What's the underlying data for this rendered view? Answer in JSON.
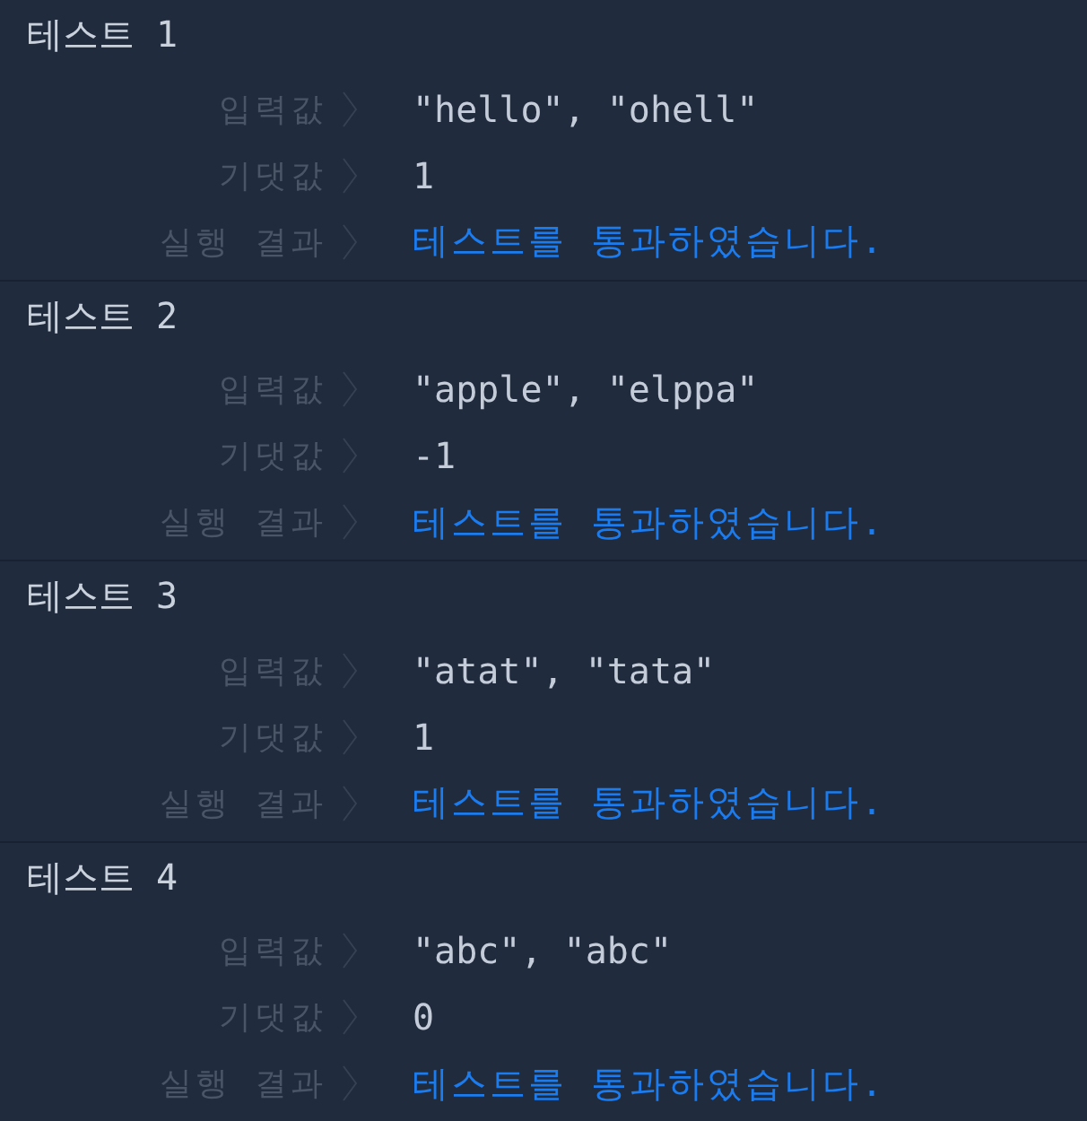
{
  "tests": [
    {
      "title": "테스트 1",
      "rows": [
        {
          "label": "입력값",
          "value": "\"hello\", \"ohell\"",
          "kind": "value"
        },
        {
          "label": "기댓값",
          "value": "1",
          "kind": "value"
        },
        {
          "label": "실행 결과",
          "value": "테스트를 통과하였습니다.",
          "kind": "result"
        }
      ]
    },
    {
      "title": "테스트 2",
      "rows": [
        {
          "label": "입력값",
          "value": "\"apple\", \"elppa\"",
          "kind": "value"
        },
        {
          "label": "기댓값",
          "value": "-1",
          "kind": "value"
        },
        {
          "label": "실행 결과",
          "value": "테스트를 통과하였습니다.",
          "kind": "result"
        }
      ]
    },
    {
      "title": "테스트 3",
      "rows": [
        {
          "label": "입력값",
          "value": "\"atat\", \"tata\"",
          "kind": "value"
        },
        {
          "label": "기댓값",
          "value": "1",
          "kind": "value"
        },
        {
          "label": "실행 결과",
          "value": "테스트를 통과하였습니다.",
          "kind": "result"
        }
      ]
    },
    {
      "title": "테스트 4",
      "rows": [
        {
          "label": "입력값",
          "value": "\"abc\", \"abc\"",
          "kind": "value"
        },
        {
          "label": "기댓값",
          "value": "0",
          "kind": "value"
        },
        {
          "label": "실행 결과",
          "value": "테스트를 통과하였습니다.",
          "kind": "result"
        }
      ]
    }
  ]
}
